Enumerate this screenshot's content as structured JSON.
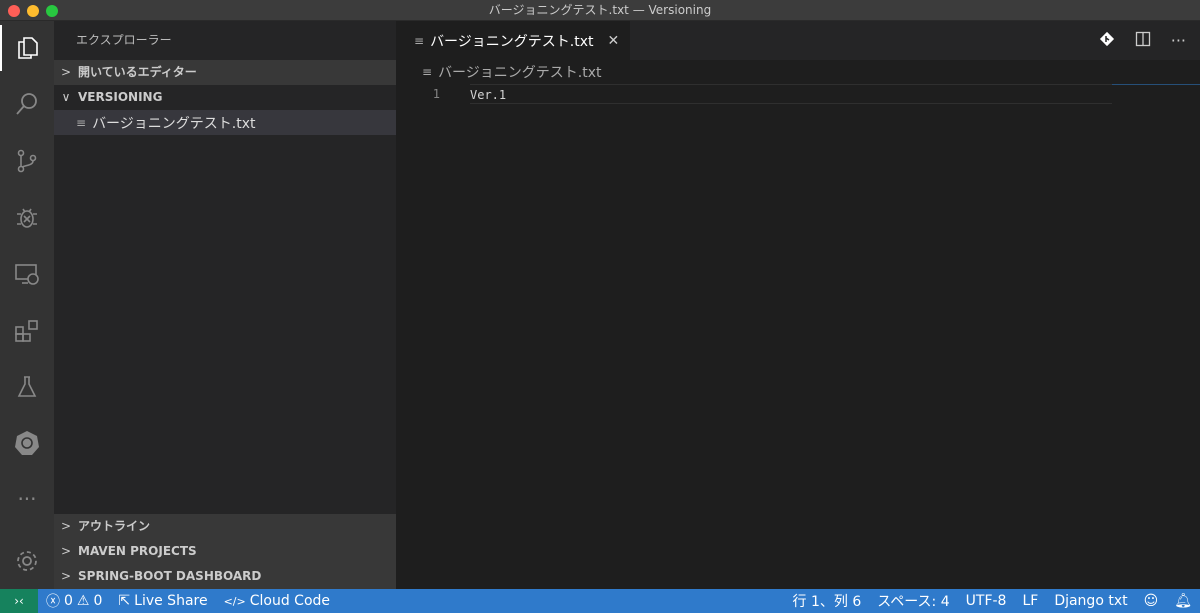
{
  "window": {
    "title": "バージョニングテスト.txt — Versioning"
  },
  "activity_bar": [
    "explorer",
    "search",
    "source-control",
    "debug",
    "remote-explorer",
    "extensions",
    "testing",
    "kubernetes",
    "more",
    "settings"
  ],
  "sidebar": {
    "title": "エクスプローラー",
    "sections": {
      "open_editors": "開いているエディター",
      "folder": "VERSIONING",
      "outline": "アウトライン",
      "maven": "MAVEN PROJECTS",
      "spring": "SPRING-BOOT DASHBOARD"
    },
    "files": [
      "バージョニングテスト.txt"
    ]
  },
  "editor": {
    "tab_label": "バージョニングテスト.txt",
    "breadcrumb": "バージョニングテスト.txt",
    "lines": [
      {
        "number": "1",
        "text": "Ver.1"
      }
    ],
    "more": "···"
  },
  "status_bar": {
    "errors": "0",
    "warnings": "0",
    "live_share": "Live Share",
    "cloud_code": "Cloud Code",
    "position": "行 1、列 6",
    "indent": "スペース: 4",
    "encoding": "UTF-8",
    "eol": "LF",
    "language": "Django txt"
  }
}
